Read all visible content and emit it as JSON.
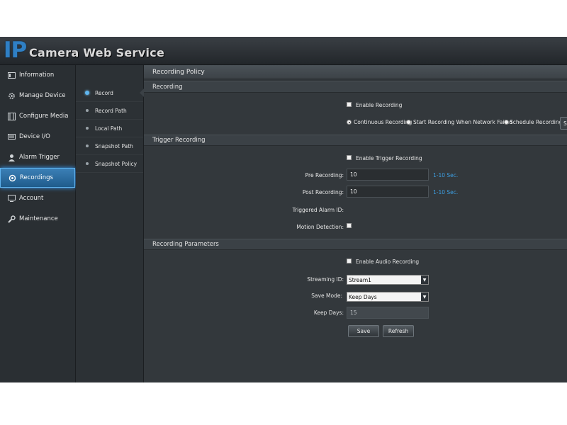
{
  "header": {
    "logo_ip": "IP",
    "title": "Camera Web Service"
  },
  "nav": {
    "items": [
      {
        "label": "Information",
        "icon": "monitor-icon",
        "active": false
      },
      {
        "label": "Manage Device",
        "icon": "gear-icon",
        "active": false
      },
      {
        "label": "Configure Media",
        "icon": "film-icon",
        "active": false
      },
      {
        "label": "Device I/O",
        "icon": "keyboard-icon",
        "active": false
      },
      {
        "label": "Alarm Trigger",
        "icon": "person-icon",
        "active": false
      },
      {
        "label": "Recordings",
        "icon": "recordings-gear-icon",
        "active": true
      },
      {
        "label": "Account",
        "icon": "display-icon",
        "active": false
      },
      {
        "label": "Maintenance",
        "icon": "wrench-icon",
        "active": false
      }
    ]
  },
  "subnav": {
    "items": [
      {
        "label": "Record",
        "active": true
      },
      {
        "label": "Record Path",
        "active": false
      },
      {
        "label": "Local Path",
        "active": false
      },
      {
        "label": "Snapshot Path",
        "active": false
      },
      {
        "label": "Snapshot Policy",
        "active": false
      }
    ]
  },
  "main": {
    "page_title": "Recording Policy",
    "recording": {
      "section_title": "Recording",
      "enable_label": "Enable Recording",
      "radio_continuous": "Continuous Recording",
      "radio_network_failed": "Start Recording When Network Failed",
      "radio_schedule": "Schedule Recording",
      "schedule_button": "Se"
    },
    "trigger": {
      "section_title": "Trigger Recording",
      "enable_label": "Enable Trigger Recording",
      "pre_label": "Pre Recording:",
      "pre_value": "10",
      "pre_hint": "1-10 Sec.",
      "post_label": "Post Recording:",
      "post_value": "10",
      "post_hint": "1-10 Sec.",
      "alarm_id_label": "Triggered Alarm ID:",
      "motion_label": "Motion Detection:"
    },
    "params": {
      "section_title": "Recording Parameters",
      "audio_label": "Enable Audio Recording",
      "stream_label": "Streaming ID:",
      "stream_value": "Stream1",
      "save_mode_label": "Save Mode:",
      "save_mode_value": "Keep Days",
      "keep_days_label": "Keep Days:",
      "keep_days_value": "15",
      "save_button": "Save",
      "refresh_button": "Refresh"
    }
  },
  "colors": {
    "accent": "#2f7fc4",
    "hint": "#3d9ee0",
    "active_nav": "#2a70a8"
  }
}
